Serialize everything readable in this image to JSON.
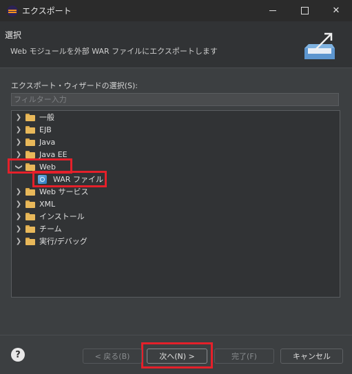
{
  "window": {
    "title": "エクスポート"
  },
  "header": {
    "title": "選択",
    "description": "Web モジュールを外部 WAR ファイルにエクスポートします"
  },
  "wizard": {
    "label": "エクスポート・ウィザードの選択(S):",
    "filter_placeholder": "フィルター入力"
  },
  "tree": {
    "items": [
      {
        "label": "一般",
        "expanded": false
      },
      {
        "label": "EJB",
        "expanded": false
      },
      {
        "label": "Java",
        "expanded": false
      },
      {
        "label": "Java EE",
        "expanded": false
      },
      {
        "label": "Web",
        "expanded": true
      },
      {
        "label": "WAR ファイル",
        "child": true
      },
      {
        "label": "Web サービス",
        "expanded": false
      },
      {
        "label": "XML",
        "expanded": false
      },
      {
        "label": "インストール",
        "expanded": false
      },
      {
        "label": "チーム",
        "expanded": false
      },
      {
        "label": "実行/デバッグ",
        "expanded": false
      }
    ]
  },
  "buttons": {
    "help": "?",
    "back": "< 戻る(B)",
    "next": "次へ(N) >",
    "finish": "完了(F)",
    "cancel": "キャンセル"
  },
  "colors": {
    "highlight": "#e5202a",
    "folder": "#e8b85a",
    "accent_icon": "#2f7abf"
  }
}
